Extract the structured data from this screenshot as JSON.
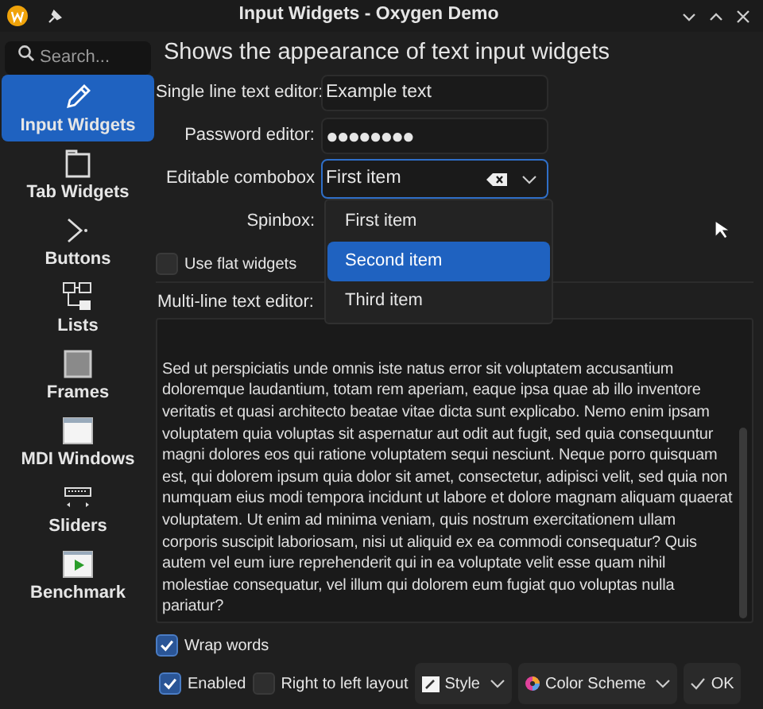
{
  "window": {
    "title": "Input Widgets - Oxygen Demo"
  },
  "search": {
    "placeholder": "Search..."
  },
  "sidebar": {
    "items": [
      {
        "label": "Input Widgets",
        "selected": true
      },
      {
        "label": "Tab Widgets",
        "selected": false
      },
      {
        "label": "Buttons",
        "selected": false
      },
      {
        "label": "Lists",
        "selected": false
      },
      {
        "label": "Frames",
        "selected": false
      },
      {
        "label": "MDI Windows",
        "selected": false
      },
      {
        "label": "Sliders",
        "selected": false
      },
      {
        "label": "Benchmark",
        "selected": false
      }
    ]
  },
  "heading": "Shows the appearance of text input widgets",
  "form": [
    {
      "kind": "text",
      "label": "Single line text editor:",
      "value": "Example text"
    },
    {
      "kind": "password",
      "label": "Password editor:",
      "value": "●●●●●●●●"
    },
    {
      "kind": "combo",
      "label": "Editable combobox",
      "value": "First item"
    },
    {
      "kind": "spin",
      "label": "Spinbox:"
    }
  ],
  "flat_widgets": {
    "label": "Use flat widgets",
    "checked": false
  },
  "dropdown": {
    "items": [
      {
        "label": "First item",
        "selected": false
      },
      {
        "label": "Second item",
        "selected": true
      },
      {
        "label": "Third item",
        "selected": false
      }
    ]
  },
  "multiline": {
    "label": "Multi-line text editor:",
    "paragraphs": [
      "Sed ut perspiciatis unde omnis iste natus error sit voluptatem accusantium doloremque laudantium, totam rem aperiam, eaque ipsa quae ab illo inventore veritatis et quasi architecto beatae vitae dicta sunt explicabo. Nemo enim ipsam voluptatem quia voluptas sit aspernatur aut odit aut fugit, sed quia consequuntur magni dolores eos qui ratione voluptatem sequi nesciunt. Neque porro quisquam est, qui dolorem ipsum quia dolor sit amet, consectetur, adipisci velit, sed quia non numquam eius modi tempora incidunt ut labore et dolore magnam aliquam quaerat voluptatem. Ut enim ad minima veniam, quis nostrum exercitationem ullam corporis suscipit laboriosam, nisi ut aliquid ex ea commodi consequatur? Quis autem vel eum iure reprehenderit qui in ea voluptate velit esse quam nihil molestiae consequatur, vel illum qui dolorem eum fugiat quo voluptas nulla pariatur?"
    ]
  },
  "wrap_words": {
    "label": "Wrap words",
    "checked": true
  },
  "bottom": {
    "enabled": {
      "label": "Enabled",
      "checked": true
    },
    "rtl": {
      "label": "Right to left layout",
      "checked": false
    },
    "style_button": "Style",
    "scheme_button": "Color Scheme",
    "ok_button": "OK"
  }
}
